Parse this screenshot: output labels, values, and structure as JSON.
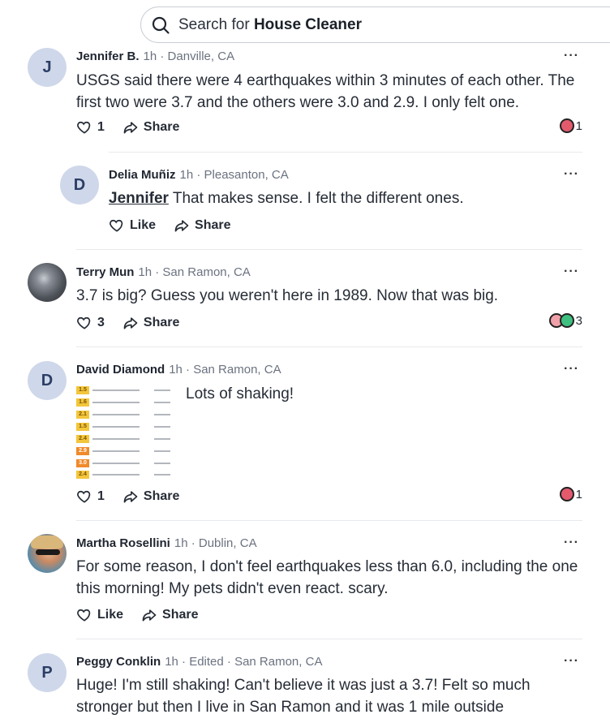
{
  "search": {
    "prefix": "Search for ",
    "term": "House Cleaner"
  },
  "colors": {
    "avatar_bg": "#cfd8ea",
    "heart_reaction": "#e35a6d",
    "thumbs_reaction": "#3fbf7f",
    "meta_gray": "#6b7280"
  },
  "labels": {
    "share": "Share",
    "like": "Like",
    "more": "···"
  },
  "comments": [
    {
      "initial": "J",
      "name": "Jennifer B.",
      "meta": "1h · Danville, CA",
      "text": "USGS said there were 4 earthquakes within  3 minutes of each other. The first two were 3.7 and the others were 3.0 and 2.9.  I only felt one.",
      "likes": "1",
      "reaction_count": "1"
    },
    {
      "initial": "D",
      "name": "Delia Muñiz",
      "meta": "1h · Pleasanton, CA",
      "mention": "Jennifer",
      "text": " That makes sense.  I felt the different ones."
    },
    {
      "initial": "",
      "name": "Terry Mun",
      "meta": "1h · San Ramon, CA",
      "text": "3.7 is big? Guess you weren't here in 1989. Now that was big.",
      "likes": "3",
      "reaction_count": "3"
    },
    {
      "initial": "D",
      "name": "David Diamond",
      "meta": "1h · San Ramon, CA",
      "text": "Lots of shaking!",
      "likes": "1",
      "reaction_count": "1",
      "image_magnitudes": [
        "1.5",
        "1.6",
        "2.1",
        "1.5",
        "2.4",
        "2.9",
        "3.0",
        "2.4"
      ]
    },
    {
      "initial": "",
      "name": "Martha Rosellini",
      "meta": "1h · Dublin, CA",
      "text": "For some reason, I don't feel earthquakes less than 6.0, including the one this morning! My pets didn't even react. scary."
    },
    {
      "initial": "P",
      "name": "Peggy Conklin",
      "meta": "1h · Edited · San Ramon, CA",
      "text": "Huge! I'm still shaking! Can't believe it was just a 3.7! Felt so much stronger but then I live in San Ramon and it was 1 mile outside"
    }
  ]
}
